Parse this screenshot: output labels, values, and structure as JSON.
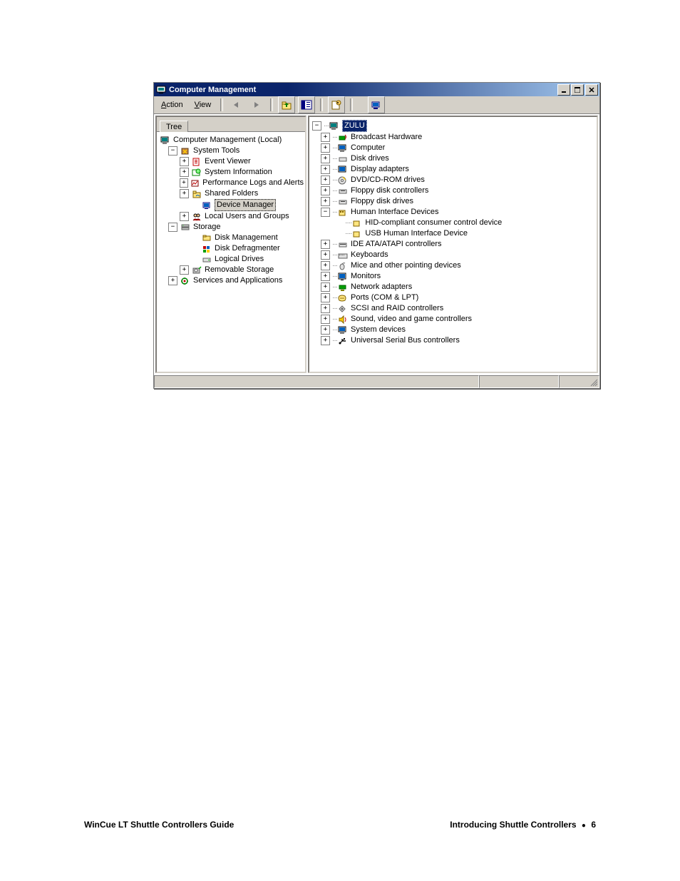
{
  "window": {
    "title": "Computer Management"
  },
  "menubar": {
    "action": "Action",
    "view": "View"
  },
  "left_pane": {
    "tab": "Tree",
    "root": "Computer Management (Local)",
    "system_tools": "System Tools",
    "event_viewer": "Event Viewer",
    "system_information": "System Information",
    "perf_logs": "Performance Logs and Alerts",
    "shared_folders": "Shared Folders",
    "device_manager": "Device Manager",
    "local_users": "Local Users and Groups",
    "storage": "Storage",
    "disk_management": "Disk Management",
    "disk_defrag": "Disk Defragmenter",
    "logical_drives": "Logical Drives",
    "removable_storage": "Removable Storage",
    "services_apps": "Services and Applications"
  },
  "right_pane": {
    "root": "ZULU",
    "broadcast_hardware": "Broadcast Hardware",
    "computer": "Computer",
    "disk_drives": "Disk drives",
    "display_adapters": "Display adapters",
    "dvd_cdrom": "DVD/CD-ROM drives",
    "floppy_ctrl": "Floppy disk controllers",
    "floppy_drives": "Floppy disk drives",
    "hid": "Human Interface Devices",
    "hid_consumer": "HID-compliant consumer control device",
    "usb_hid": "USB Human Interface Device",
    "ide": "IDE ATA/ATAPI controllers",
    "keyboards": "Keyboards",
    "mice": "Mice and other pointing devices",
    "monitors": "Monitors",
    "network_adapters": "Network adapters",
    "ports": "Ports (COM & LPT)",
    "scsi": "SCSI and RAID controllers",
    "sound": "Sound, video and game controllers",
    "system_devices": "System devices",
    "usb_ctrl": "Universal Serial Bus controllers"
  },
  "footer": {
    "left": "WinCue LT Shuttle Controllers Guide",
    "right_label": "Introducing Shuttle Controllers",
    "page": "6"
  }
}
